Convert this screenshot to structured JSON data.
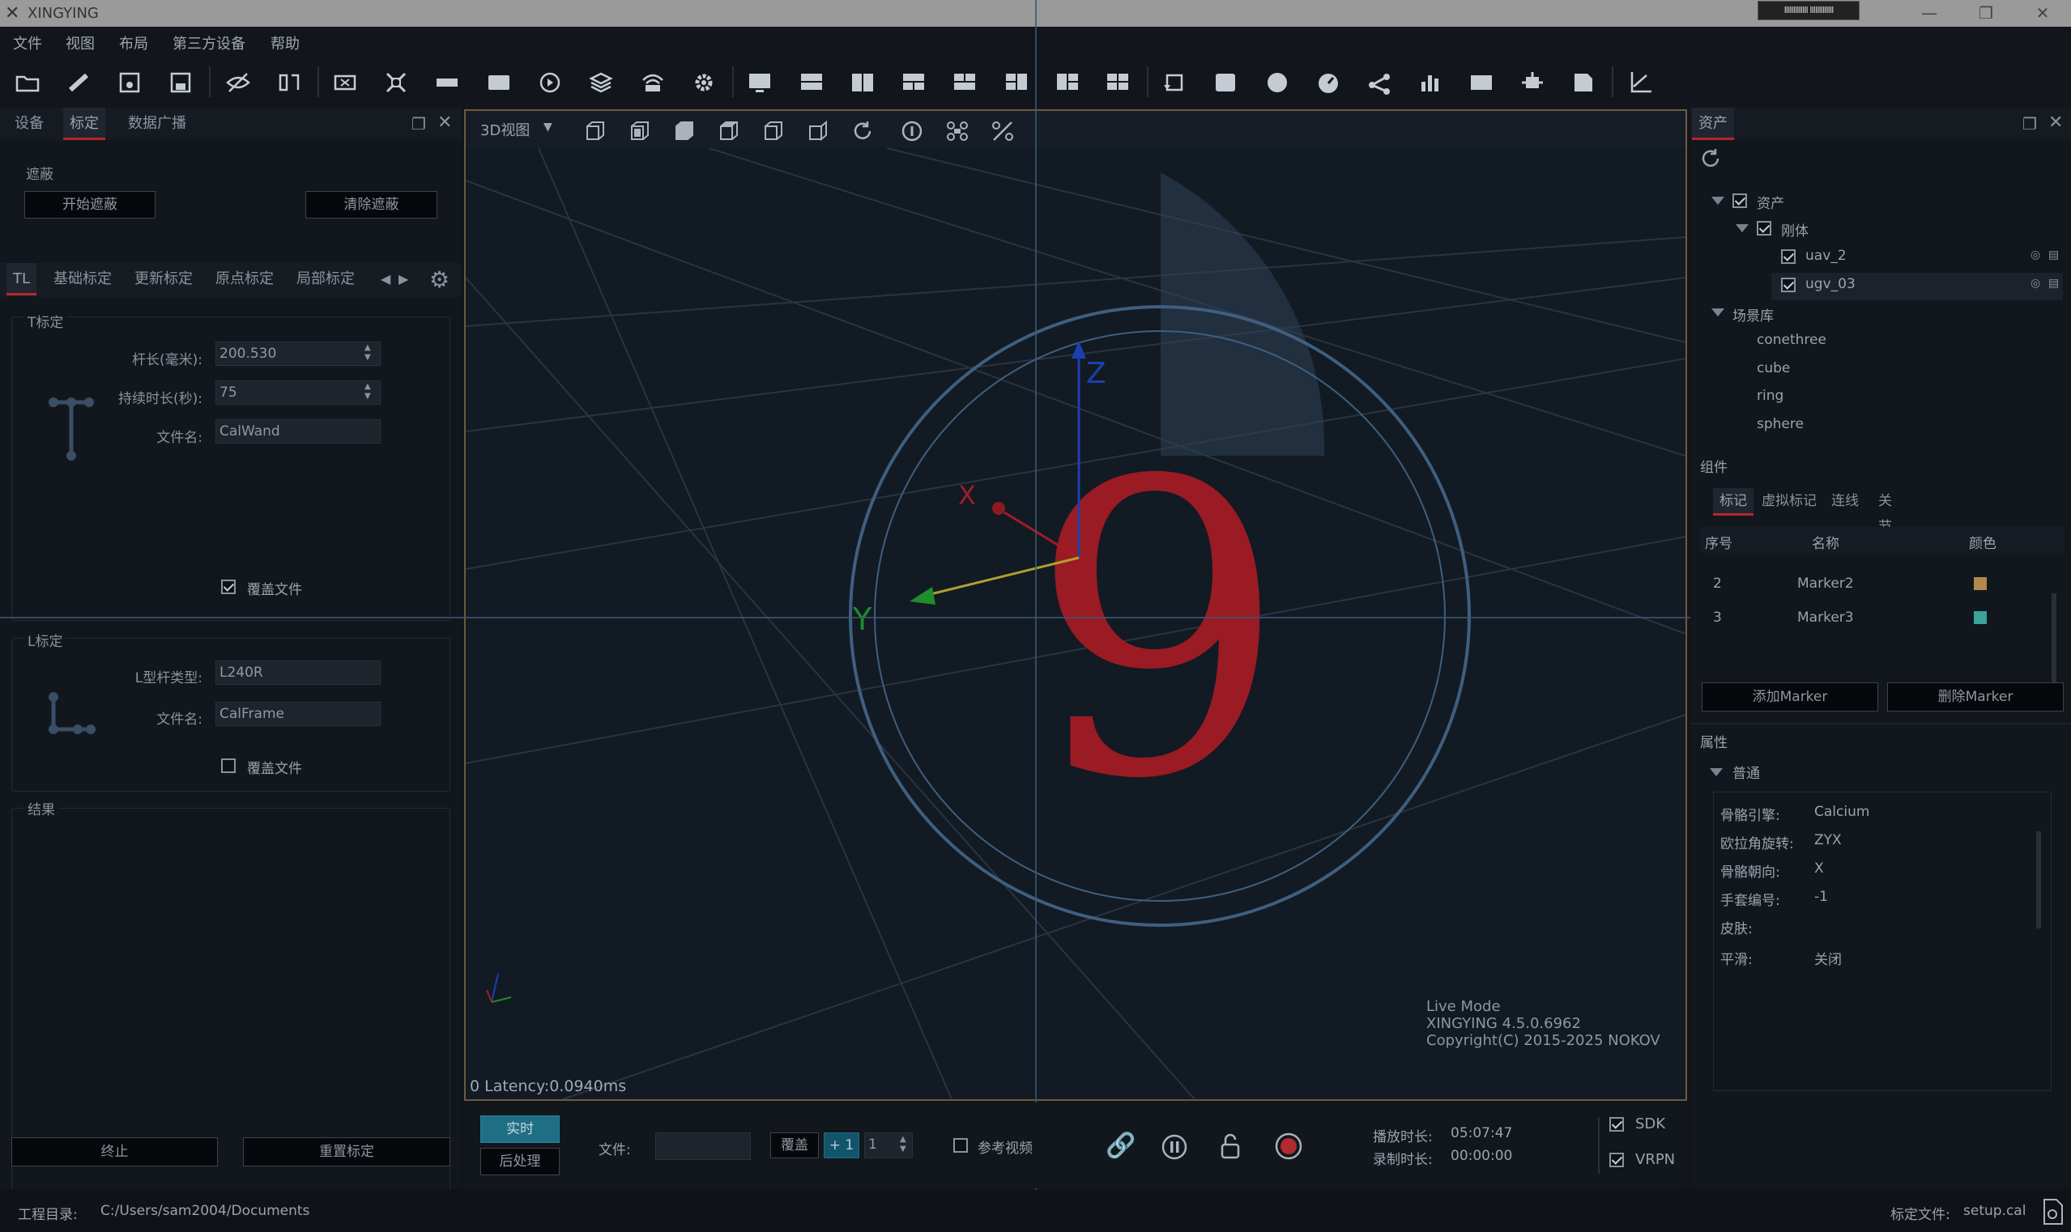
{
  "app": {
    "title": "XINGYING",
    "mini_label": "IIIIIIIIIIIII IIIIIIIIIIIII"
  },
  "menu": [
    "文件",
    "视图",
    "布局",
    "第三方设备",
    "帮助"
  ],
  "left_panel": {
    "tabs": [
      "设备",
      "标定",
      "数据广播"
    ],
    "mask_group": {
      "title": "遮蔽",
      "start_button": "开始遮蔽",
      "clear_button": "清除遮蔽"
    },
    "subtabs": [
      "TL",
      "基础标定",
      "更新标定",
      "原点标定",
      "局部标定"
    ],
    "t_calib": {
      "title": "T标定",
      "rod_length_label": "杆长(毫米):",
      "rod_length_value": "200.530",
      "duration_label": "持续时长(秒):",
      "duration_value": "75",
      "filename_label": "文件名:",
      "filename_value": "CalWand",
      "overwrite_label": "覆盖文件",
      "overwrite_checked": true
    },
    "l_calib": {
      "title": "L标定",
      "type_label": "L型杆类型:",
      "type_value": "L240R",
      "filename_label": "文件名:",
      "filename_value": "CalFrame",
      "overwrite_label": "覆盖文件",
      "overwrite_checked": false
    },
    "result": {
      "title": "结果"
    },
    "stop_button": "终止",
    "recalib_button": "重置标定"
  },
  "viewport": {
    "view_select": "3D视图",
    "countdown": "9",
    "axis_z": "Z",
    "axis_x": "X",
    "axis_y": "Y",
    "latency": "0 Latency:0.0940ms",
    "info_line1": "Live Mode",
    "info_line2": "XINGYING 4.5.0.6962",
    "info_line3": "Copyright(C) 2015-2025 NOKOV"
  },
  "bottom_bar": {
    "realtime_button": "实时",
    "postprocess_button": "后处理",
    "file_label": "文件:",
    "file_value": "",
    "overwrite_button": "覆盖",
    "plus_button": "+ 1",
    "count_value": "1",
    "ref_video_label": "参考视频",
    "play_duration_label": "播放时长:",
    "play_duration_value": "05:07:47",
    "record_duration_label": "录制时长:",
    "record_duration_value": "00:00:00",
    "sdk_label": "SDK",
    "vrpn_label": "VRPN"
  },
  "right_panel": {
    "tab": "资产",
    "tree": {
      "root": "资产",
      "rigid": "刚体",
      "items": [
        "uav_2",
        "ugv_03"
      ],
      "library": "场景库",
      "library_items": [
        "conethree",
        "cube",
        "ring",
        "sphere"
      ]
    },
    "components_title": "组件",
    "component_tabs": [
      "标记",
      "虚拟标记",
      "连线",
      "关节"
    ],
    "table_headers": [
      "序号",
      "名称",
      "颜色"
    ],
    "markers": [
      {
        "index": "2",
        "name": "Marker2",
        "color": "#b08a4a"
      },
      {
        "index": "3",
        "name": "Marker3",
        "color": "#3aa39a"
      }
    ],
    "add_marker_button": "添加Marker",
    "delete_marker_button": "删除Marker",
    "properties_title": "属性",
    "general_label": "普通",
    "props": [
      {
        "label": "骨骼引擎:",
        "value": "Calcium"
      },
      {
        "label": "欧拉角旋转:",
        "value": "ZYX"
      },
      {
        "label": "骨骼朝向:",
        "value": "X"
      },
      {
        "label": "手套编号:",
        "value": "-1"
      },
      {
        "label": "皮肤:",
        "value": ""
      },
      {
        "label": "平滑:",
        "value": "关闭"
      }
    ]
  },
  "status_bar": {
    "project_dir_label": "工程目录:",
    "project_dir_value": "C:/Users/sam2004/Documents",
    "calib_file_label": "标定文件:",
    "calib_file_value": "setup.cal"
  }
}
